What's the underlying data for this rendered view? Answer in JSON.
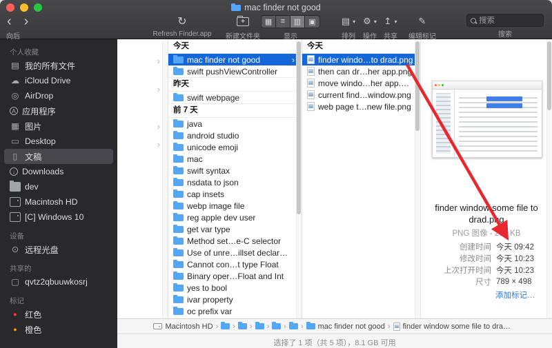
{
  "window": {
    "title": "mac finder not good"
  },
  "toolbar": {
    "back_label": "向后",
    "refresh_label": "Refresh Finder.app",
    "new_folder_label": "新建文件夹",
    "view_label": "显示",
    "arrange_label": "排列",
    "action_label": "操作",
    "share_label": "共享",
    "tags_label": "编辑标记",
    "search_label": "搜索",
    "search_placeholder": "搜索"
  },
  "icons": {
    "back": "‹",
    "forward": "›",
    "refresh": "↻",
    "new_folder_plus": "+",
    "view_grid": "▦",
    "view_list": "≡",
    "view_columns": "▥",
    "view_coverflow": "▣",
    "arrange": "▤",
    "gear": "⚙",
    "caret_down": "▾",
    "share": "↥",
    "tags": "✎",
    "chevron": "›",
    "all-files": "▤",
    "cloud": "☁",
    "airdrop": "◎",
    "app": "A",
    "photos": "▦",
    "desktop": "▭",
    "document": "▯",
    "download": "↓",
    "disc": "⊙",
    "display": "▢",
    "tag-red": "●",
    "tag-orange": "●"
  },
  "sidebar": {
    "rows": [
      {
        "type": "section",
        "label": "个人收藏"
      },
      {
        "type": "item",
        "label": "我的所有文件",
        "icon": "all-files"
      },
      {
        "type": "item",
        "label": "iCloud Drive",
        "icon": "cloud"
      },
      {
        "type": "item",
        "label": "AirDrop",
        "icon": "airdrop"
      },
      {
        "type": "item",
        "label": "应用程序",
        "icon": "app"
      },
      {
        "type": "item",
        "label": "图片",
        "icon": "photos"
      },
      {
        "type": "item",
        "label": "Desktop",
        "icon": "desktop"
      },
      {
        "type": "item",
        "label": "文稿",
        "icon": "document",
        "selected": true
      },
      {
        "type": "item",
        "label": "Downloads",
        "icon": "download"
      },
      {
        "type": "item",
        "label": "dev",
        "icon": "folder"
      },
      {
        "type": "item",
        "label": "Macintosh HD",
        "icon": "disk"
      },
      {
        "type": "item",
        "label": "[C] Windows 10",
        "icon": "disk"
      },
      {
        "type": "section",
        "label": "设备"
      },
      {
        "type": "item",
        "label": "远程光盘",
        "icon": "disc"
      },
      {
        "type": "section",
        "label": "共享的"
      },
      {
        "type": "item",
        "label": "qvtz2qbuuwkosrj",
        "icon": "display"
      },
      {
        "type": "section",
        "label": "标记"
      },
      {
        "type": "item",
        "label": "红色",
        "icon": "tag-red"
      },
      {
        "type": "item",
        "label": "橙色",
        "icon": "tag-orange"
      }
    ]
  },
  "columns": {
    "folders": [
      {
        "type": "header",
        "label": "今天"
      },
      {
        "type": "item",
        "label": "mac finder not good",
        "icon": "folder",
        "selected": true,
        "chevron": true
      },
      {
        "type": "item",
        "label": "swift pushViewController",
        "icon": "folder"
      },
      {
        "type": "header",
        "label": "昨天"
      },
      {
        "type": "item",
        "label": "swift webpage",
        "icon": "folder"
      },
      {
        "type": "header",
        "label": "前 7 天"
      },
      {
        "type": "item",
        "label": "java",
        "icon": "folder"
      },
      {
        "type": "item",
        "label": "android studio",
        "icon": "folder"
      },
      {
        "type": "item",
        "label": "unicode emoji",
        "icon": "folder"
      },
      {
        "type": "item",
        "label": "mac",
        "icon": "folder"
      },
      {
        "type": "item",
        "label": "swift syntax",
        "icon": "folder"
      },
      {
        "type": "item",
        "label": "nsdata to json",
        "icon": "folder"
      },
      {
        "type": "item",
        "label": "cap insets",
        "icon": "folder"
      },
      {
        "type": "item",
        "label": "webp image file",
        "icon": "folder"
      },
      {
        "type": "item",
        "label": "reg apple dev user",
        "icon": "folder"
      },
      {
        "type": "item",
        "label": "get var type",
        "icon": "folder"
      },
      {
        "type": "item",
        "label": "Method set…e-C selector",
        "icon": "folder"
      },
      {
        "type": "item",
        "label": "Use of unre…illset declar…",
        "icon": "folder"
      },
      {
        "type": "item",
        "label": "Cannot con…t type Float",
        "icon": "folder"
      },
      {
        "type": "item",
        "label": "Binary oper…Float and Int",
        "icon": "folder"
      },
      {
        "type": "item",
        "label": "yes to bool",
        "icon": "folder"
      },
      {
        "type": "item",
        "label": "ivar property",
        "icon": "folder"
      },
      {
        "type": "item",
        "label": "oc prefix var",
        "icon": "folder"
      }
    ],
    "files": [
      {
        "type": "header",
        "label": "今天"
      },
      {
        "type": "item",
        "label": "finder windo…to drad.png",
        "icon": "image",
        "selected": true
      },
      {
        "type": "item",
        "label": "then can dr…her app.png",
        "icon": "image"
      },
      {
        "type": "item",
        "label": "move windo…her app.png",
        "icon": "image"
      },
      {
        "type": "item",
        "label": "current find…window.png",
        "icon": "image"
      },
      {
        "type": "item",
        "label": "web page t…new file.png",
        "icon": "image"
      }
    ]
  },
  "preview": {
    "filename": "finder window some file to drad.png",
    "kind_size": "PNG 图像 - 200 KB",
    "meta": [
      {
        "label": "创建时间",
        "value": "今天 09:42"
      },
      {
        "label": "修改时间",
        "value": "今天 10:23"
      },
      {
        "label": "上次打开时间",
        "value": "今天 10:23"
      },
      {
        "label": "尺寸",
        "value": "789 × 498"
      }
    ],
    "add_tags_label": "添加标记…"
  },
  "pathbar": {
    "items": [
      {
        "icon": "disk",
        "label": "Macintosh HD",
        "sep": "›"
      },
      {
        "icon": "folder",
        "label": "",
        "sep": "›"
      },
      {
        "icon": "folder",
        "label": "",
        "sep": "›"
      },
      {
        "icon": "folder",
        "label": "",
        "sep": "›"
      },
      {
        "icon": "folder",
        "label": "",
        "sep": "›"
      },
      {
        "icon": "folder",
        "label": "",
        "sep": "›"
      },
      {
        "icon": "folder",
        "label": "mac finder not good",
        "sep": "›"
      },
      {
        "icon": "file",
        "label": "finder window some file to drad.png",
        "sep": ""
      }
    ]
  },
  "statusbar": {
    "text": "选择了 1 项（共 5 项），8.1 GB 可用"
  }
}
